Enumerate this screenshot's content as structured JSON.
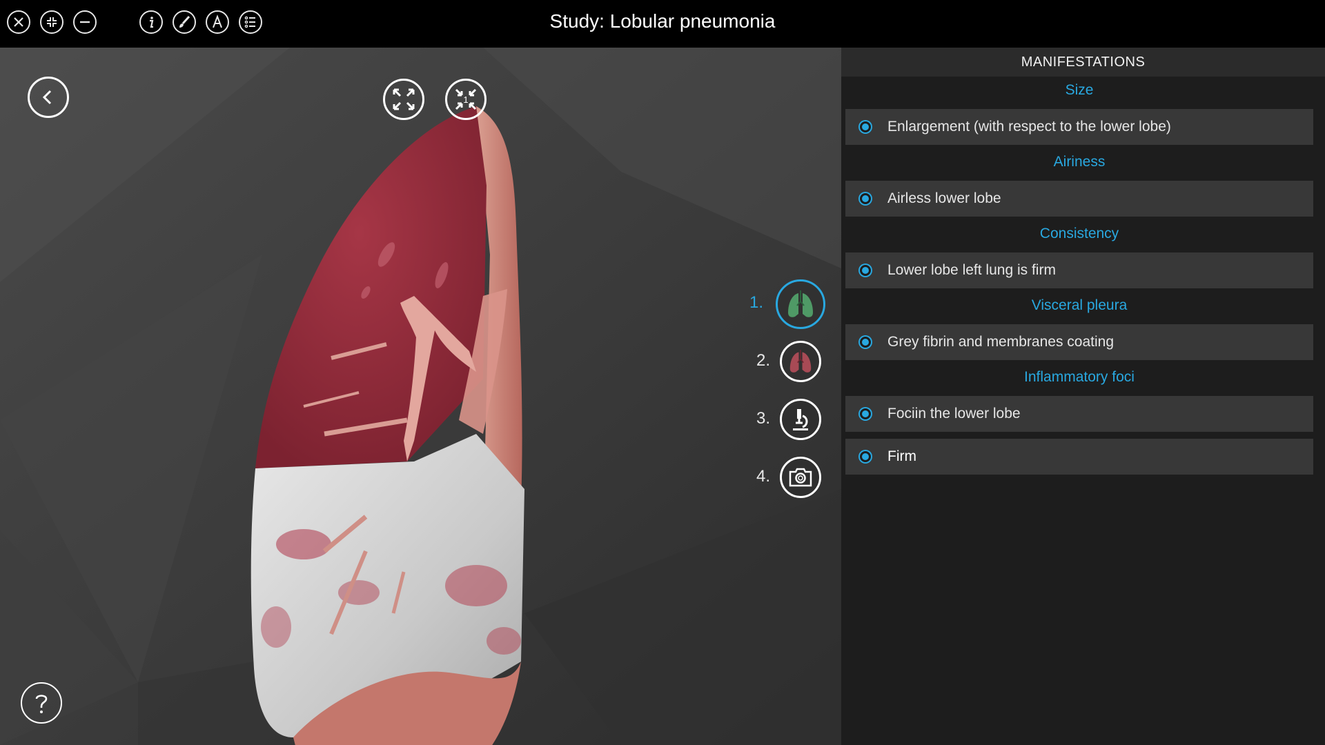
{
  "toolbar": {
    "left_icons": [
      "close-icon",
      "collapse-icon",
      "minimize-icon"
    ],
    "right_icons": [
      "info-icon",
      "brush-icon",
      "text-icon",
      "list-icon"
    ]
  },
  "title": "Study: Lobular pneumonia",
  "viewport": {
    "back_icon": "chevron-left-icon",
    "expand_icon": "expand-icon",
    "shrink_badge": "1",
    "help_icon": "help-icon"
  },
  "steps": [
    {
      "number": "1.",
      "icon": "lungs-green-icon",
      "active": true
    },
    {
      "number": "2.",
      "icon": "lungs-red-icon",
      "active": false
    },
    {
      "number": "3.",
      "icon": "microscope-icon",
      "active": false
    },
    {
      "number": "4.",
      "icon": "camera-icon",
      "active": false
    }
  ],
  "panel": {
    "heading": "MANIFESTATIONS",
    "categories": [
      {
        "label": "Size",
        "items": [
          "Enlargement (with respect to the lower lobe)"
        ]
      },
      {
        "label": "Airiness",
        "items": [
          "Airless lower lobe"
        ]
      },
      {
        "label": "Consistency",
        "items": [
          "Lower lobe left lung is firm"
        ]
      },
      {
        "label": "Visceral pleura",
        "items": [
          "Grey fibrin and membranes coating"
        ]
      },
      {
        "label": "Inflammatory foci",
        "items": [
          "Fociin the lower lobe",
          "Firm"
        ]
      }
    ]
  },
  "colors": {
    "accent": "#29a8e0",
    "panel_bg": "#1d1d1d",
    "item_bg": "#383838",
    "lung_red": "#9e2f3c",
    "lung_pale": "#d9d9d9"
  }
}
